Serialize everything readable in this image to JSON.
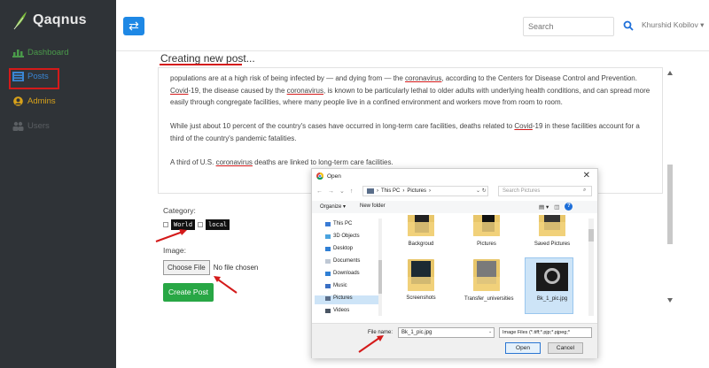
{
  "app": {
    "brand": "Qaqnus"
  },
  "sidebar": {
    "items": [
      {
        "label": "Dashboard"
      },
      {
        "label": "Posts"
      },
      {
        "label": "Admins"
      },
      {
        "label": "Users"
      }
    ]
  },
  "topbar": {
    "search_placeholder": "Search",
    "user_name": "Khurshid Kobilov ▾"
  },
  "page": {
    "title": "Creating new post...",
    "paragraphs": [
      [
        {
          "t": "populations are at a high risk of being infected by — and dying from — the "
        },
        {
          "t": "coronavirus",
          "kw": true
        },
        {
          "t": ", according to the Centers for Disease Control and Prevention. "
        },
        {
          "t": "Covid",
          "kw": true
        },
        {
          "t": "-19, the disease caused by the "
        },
        {
          "t": "coronavirus",
          "kw": true
        },
        {
          "t": ", is known to be particularly lethal to older adults with underlying health conditions, and can spread more easily through congregate facilities, where many people live in a confined environment and workers move from room to room."
        }
      ],
      [
        {
          "t": "While just about 10 percent of the country's cases have occurred in long-term care facilities, deaths related to "
        },
        {
          "t": "Covid",
          "kw": true
        },
        {
          "t": "-19 in these facilities account for a third of the country's pandemic fatalities."
        }
      ],
      [
        {
          "t": "A third of U.S. "
        },
        {
          "t": "coronavirus",
          "kw": true
        },
        {
          "t": " deaths are linked to long-term care facilities."
        }
      ]
    ],
    "category_label": "Category:",
    "tags": [
      "World",
      "local"
    ],
    "image_label": "Image:",
    "choose_file": "Choose File",
    "no_file": "No file chosen",
    "create_button": "Create Post"
  },
  "dialog": {
    "title": "Open",
    "close": "✕",
    "path": [
      "This PC",
      "Pictures"
    ],
    "search_placeholder": "Search Pictures",
    "organize": "Organize ▾",
    "new_folder": "New folder",
    "nav_items": [
      "This PC",
      "3D Objects",
      "Desktop",
      "Documents",
      "Downloads",
      "Music",
      "Pictures",
      "Videos"
    ],
    "files": [
      "Backgroud",
      "Pictures",
      "Saved Pictures",
      "Screenshots",
      "Transfer_universities",
      "Bk_1_pic.jpg"
    ],
    "file_name_label": "File name:",
    "file_name": "Bk_1_pic.jpg",
    "filter": "Image Files (*.tiff;*.pjp;*.pjpeg;*",
    "open_button": "Open",
    "cancel_button": "Cancel"
  },
  "colors": {
    "sidebar_bg": "#2f3337",
    "accent_blue": "#1e88e5",
    "create_green": "#28a745",
    "annotation_red": "#d41a1a"
  }
}
